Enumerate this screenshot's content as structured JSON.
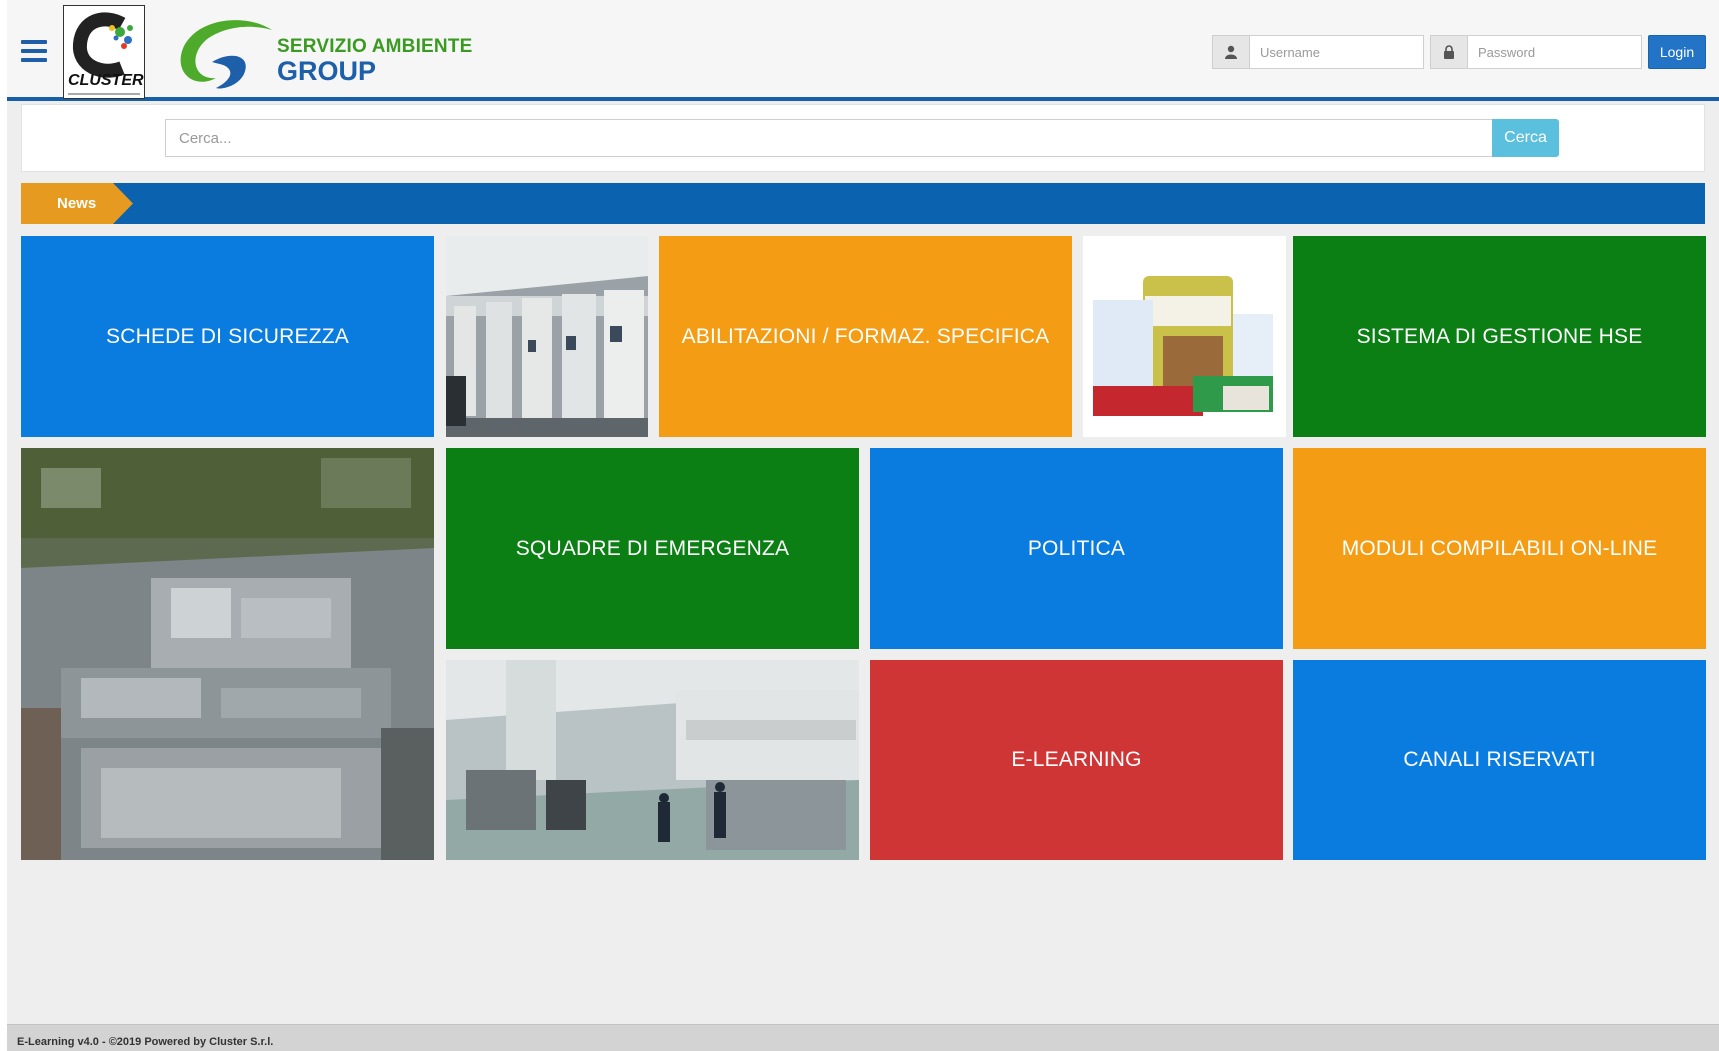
{
  "header": {
    "cluster_logo_text": "CLUSTER",
    "brand_line1": "SERVIZIO AMBIENTE",
    "brand_line2": "GROUP",
    "username_placeholder": "Username",
    "password_placeholder": "Password",
    "login_label": "Login",
    "icons": {
      "menu": "hamburger-icon",
      "user": "user-icon",
      "lock": "lock-icon"
    }
  },
  "search": {
    "placeholder": "Cerca...",
    "button_label": "Cerca"
  },
  "news": {
    "label": "News"
  },
  "tiles": {
    "schede": "SCHEDE DI SICUREZZA",
    "abilitazioni": "ABILITAZIONI / FORMAZ. SPECIFICA",
    "sistema": "SISTEMA DI GESTIONE HSE",
    "squadre": "SQUADRE DI EMERGENZA",
    "politica": "POLITICA",
    "moduli": "MODULI COMPILABILI ON-LINE",
    "elearning": "E-LEARNING",
    "canali": "CANALI RISERVATI"
  },
  "footer": {
    "text": "E-Learning v4.0 - ©2019 Powered by Cluster S.r.l."
  },
  "colors": {
    "blue": "#0a7ce0",
    "orange": "#f39c14",
    "green": "#0b7f14",
    "red": "#d03535",
    "news_bar": "#0b62ae",
    "news_tag": "#e69a1f"
  }
}
